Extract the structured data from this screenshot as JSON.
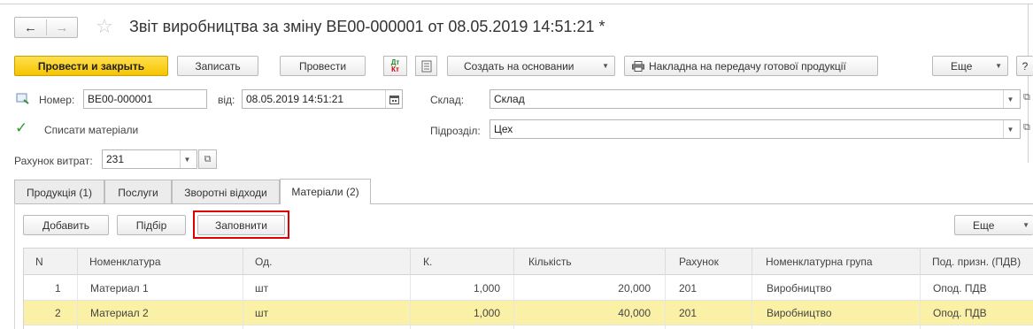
{
  "header": {
    "title": "Звіт виробництва за зміну ВЕ00-000001 от 08.05.2019 14:51:21 *",
    "back_icon": "arrow-left-icon",
    "forward_icon": "arrow-right-icon",
    "favorite_icon": "star-icon"
  },
  "toolbar": {
    "post_close_label": "Провести и закрыть",
    "write_label": "Записать",
    "post_label": "Провести",
    "create_based_label": "Создать на основании",
    "invoice_label": "Накладна на передачу готової продукції",
    "more_label": "Еще",
    "help_label": "?"
  },
  "form": {
    "number_label": "Номер:",
    "number_value": "ВЕ00-000001",
    "date_label": "від:",
    "date_value": "08.05.2019 14:51:21",
    "warehouse_label": "Склад:",
    "warehouse_value": "Склад",
    "writeoff_label": "Списати  матеріали",
    "writeoff_checked": true,
    "division_label": "Підрозділ:",
    "division_value": "Цех",
    "cost_account_label": "Рахунок витрат:",
    "cost_account_value": "231"
  },
  "tabs": [
    {
      "label": "Продукція (1)"
    },
    {
      "label": "Послуги"
    },
    {
      "label": "Зворотні відходи"
    },
    {
      "label": "Матеріали (2)",
      "active": true
    }
  ],
  "table_toolbar": {
    "add_label": "Добавить",
    "pick_label": "Підбір",
    "fill_label": "Заповнити",
    "more_label": "Еще"
  },
  "table": {
    "columns": [
      "N",
      "Номенклатура",
      "Од.",
      "К.",
      "Кількість",
      "Рахунок",
      "Номенклатурна група",
      "Под. призн. (ПДВ)"
    ],
    "rows": [
      [
        "1",
        "Материал 1",
        "шт",
        "1,000",
        "20,000",
        "201",
        "Виробництво",
        "Опод. ПДВ"
      ],
      [
        "2",
        "Материал 2",
        "шт",
        "1,000",
        "40,000",
        "201",
        "Виробництво",
        "Опод. ПДВ"
      ]
    ]
  },
  "colors": {
    "primary_button": "#f6c400",
    "highlight_border": "#e00000",
    "selected_row": "#fbf1a6"
  }
}
